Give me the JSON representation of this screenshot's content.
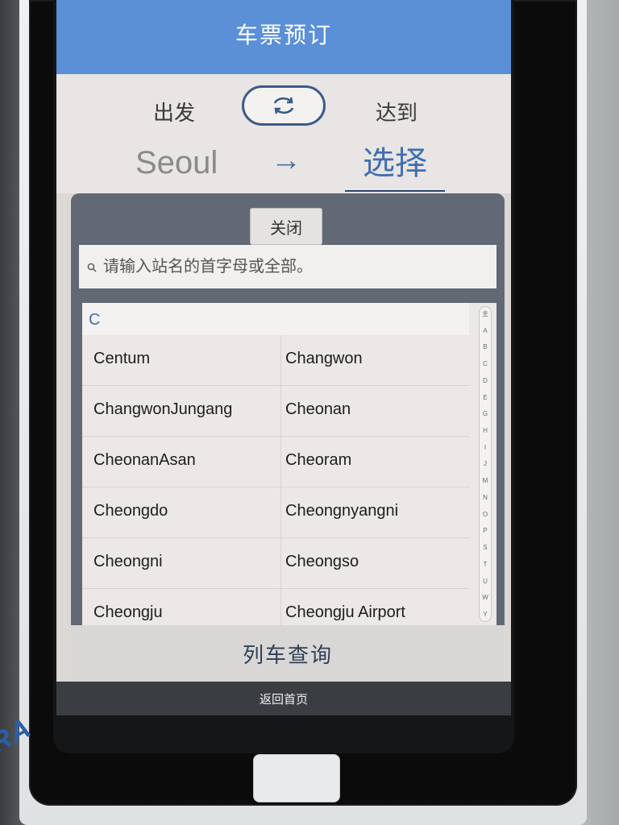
{
  "header": {
    "title": "车票预订"
  },
  "route": {
    "depart_label": "出发",
    "arrive_label": "达到",
    "origin": "Seoul",
    "destination": "选择",
    "swap_icon": "swap-arrows-icon",
    "arrow_icon": "right-arrow-icon"
  },
  "panel": {
    "close_label": "关闭",
    "search": {
      "placeholder": "请输入站名的首字母或全部。"
    },
    "section_letter": "C",
    "stations": [
      [
        "Centum",
        "Changwon"
      ],
      [
        "ChangwonJungang",
        "Cheonan"
      ],
      [
        "CheonanAsan",
        "Cheoram"
      ],
      [
        "Cheongdo",
        "Cheongnyangni"
      ],
      [
        "Cheongni",
        "Cheongso"
      ],
      [
        "Cheongju",
        "Cheongju Airport"
      ]
    ],
    "alpha_index": [
      "主",
      "A",
      "B",
      "C",
      "D",
      "E",
      "G",
      "H",
      "I",
      "J",
      "M",
      "N",
      "O",
      "P",
      "S",
      "T",
      "U",
      "W",
      "Y"
    ],
    "query_label": "列车查询"
  },
  "footer": {
    "home_label": "返回首页"
  },
  "colors": {
    "header_bg": "#5b8fd6",
    "accent": "#3f6fb0"
  }
}
